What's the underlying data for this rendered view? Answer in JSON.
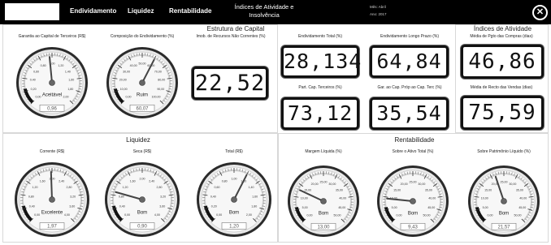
{
  "nav": {
    "tab_1": "Endividamento",
    "tab_2": "Liquidez",
    "tab_3": "Rentabilidade",
    "tab_4_line1": "Índices de Atividade e",
    "tab_4_line2": "Insolvência",
    "mes": "Mês: Abril",
    "ano": "Ano: 2017"
  },
  "sections": {
    "capital": "Estrutura de Capital",
    "atividade": "Índices de Atividade",
    "liquidez": "Liquidez",
    "rentabilidade": "Rentabilidade"
  },
  "gauges": [
    {
      "id": "garantia",
      "title": "Garantia ao Capital de Terceiros (R$)",
      "status": "Aceitável",
      "readout": "0,96",
      "value": 0.96,
      "min": 0,
      "max": 2.0,
      "ticks": [
        "0,00",
        "0,20",
        "0,40",
        "0,60",
        "0,80",
        "1,00",
        "1,20",
        "1,40",
        "1,60",
        "1,80",
        "2,00"
      ]
    },
    {
      "id": "composicao",
      "title": "Composição do Endividamento (%)",
      "status": "Ruim",
      "readout": "60,07",
      "value": 60.07,
      "min": 0,
      "max": 100,
      "ticks": [
        "0,00",
        "10,00",
        "20,00",
        "30,00",
        "40,00",
        "50,00",
        "60,00",
        "70,00",
        "80,00",
        "90,00",
        "100,00"
      ]
    },
    {
      "id": "corrente",
      "title": "Corrente (R$)",
      "status": "Excelente",
      "readout": "1,97",
      "value": 1.97,
      "min": 0,
      "max": 4.0,
      "ticks": [
        "0,00",
        "0,40",
        "0,80",
        "1,20",
        "1,60",
        "2,00",
        "2,40",
        "2,80",
        "3,20",
        "3,60",
        "4,00"
      ]
    },
    {
      "id": "seca",
      "title": "Seca (R$)",
      "status": "Bom",
      "readout": "0,90",
      "value": 0.9,
      "min": 0,
      "max": 4.0,
      "ticks": [
        "0,00",
        "0,40",
        "0,80",
        "1,20",
        "1,60",
        "2,00",
        "2,40",
        "2,80",
        "3,20",
        "3,60",
        "4,00"
      ]
    },
    {
      "id": "total",
      "title": "Total (R$)",
      "status": "Bom",
      "readout": "1,20",
      "value": 1.2,
      "min": 0,
      "max": 2.0,
      "ticks": [
        "0,00",
        "0,20",
        "0,40",
        "0,60",
        "0,80",
        "1,00",
        "1,20",
        "1,40",
        "1,60",
        "1,80",
        "2,00"
      ]
    },
    {
      "id": "margem",
      "title": "Margem Líquida (%)",
      "status": "Bom",
      "readout": "13,00",
      "value": 13.0,
      "min": 0,
      "max": 50,
      "ticks": [
        "0,00",
        "5,00",
        "10,00",
        "15,00",
        "20,00",
        "25,00",
        "30,00",
        "35,00",
        "40,00",
        "45,00",
        "50,00"
      ]
    },
    {
      "id": "ativo",
      "title": "Sobre o Ativo Total (%)",
      "status": "Bom",
      "readout": "9,43",
      "value": 9.43,
      "min": 0,
      "max": 50,
      "ticks": [
        "0,00",
        "5,00",
        "10,00",
        "15,00",
        "20,00",
        "25,00",
        "30,00",
        "35,00",
        "40,00",
        "45,00",
        "50,00"
      ]
    },
    {
      "id": "patrimonio",
      "title": "Sobre Patrimônio Líquido (%)",
      "status": "Bom",
      "readout": "21,57",
      "value": 21.57,
      "min": 0,
      "max": 50,
      "ticks": [
        "0,00",
        "5,00",
        "10,00",
        "15,00",
        "20,00",
        "25,00",
        "30,00",
        "35,00",
        "40,00",
        "45,00",
        "50,00"
      ]
    }
  ],
  "lcds": {
    "imob": {
      "label": "Imob. de Recursos Não Correntes (%)",
      "value": "22,52"
    },
    "endiv_total": {
      "label": "Endividamento Total (%)",
      "value": "28,134"
    },
    "endiv_longo": {
      "label": "Endividamento Longo Prazo (%)",
      "value": "64,84"
    },
    "part_cap": {
      "label": "Part. Cap. Terceiros (%)",
      "value": "73,12"
    },
    "gar_cap": {
      "label": "Gar. ao Cap. Próp ao Cap. Terc (%)",
      "value": "35,54"
    },
    "pgto": {
      "label": "Média de Pgto das Compras (dias)",
      "value": "46,86"
    },
    "recto": {
      "label": "Média de Recto das Vendas (dias)",
      "value": "75,59"
    }
  },
  "colors": {
    "bar": "#000000",
    "good": "#1a1a1a",
    "bad": "#555555"
  }
}
